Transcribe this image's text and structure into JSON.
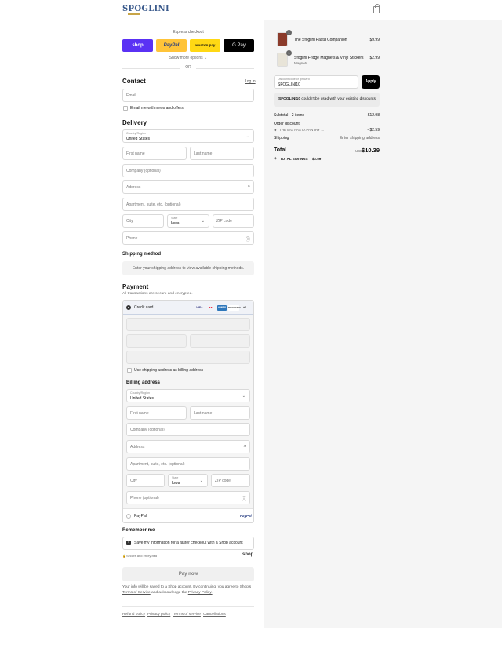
{
  "header": {
    "logo": "SPOGLINI",
    "cart_icon": "shopping-bag-icon"
  },
  "express": {
    "title": "Express checkout",
    "shop": "shop",
    "paypal": "PayPal",
    "amazon": "amazon pay",
    "gpay": "G Pay",
    "show_more": "Show more options ⌄",
    "or": "OR"
  },
  "contact": {
    "title": "Contact",
    "login": "Log in",
    "email_placeholder": "Email",
    "newsletter": "Email me with news and offers"
  },
  "delivery": {
    "title": "Delivery",
    "country_label": "Country/Region",
    "country_value": "United States",
    "first_name": "First name",
    "last_name": "Last name",
    "company": "Company (optional)",
    "address": "Address",
    "apartment": "Apartment, suite, etc. (optional)",
    "city": "City",
    "state_label": "State",
    "state_value": "Iowa",
    "zip": "ZIP code",
    "phone": "Phone"
  },
  "shipping_method": {
    "title": "Shipping method",
    "message": "Enter your shipping address to view available shipping methods."
  },
  "payment": {
    "title": "Payment",
    "subtitle": "All transactions are secure and encrypted.",
    "credit_card": "Credit card",
    "cards": [
      "VISA",
      "MC",
      "AMEX",
      "DISCOVER"
    ],
    "more_cards": "+5",
    "same_billing": "Use shipping address as billing address",
    "billing_title": "Billing address",
    "country_label": "Country/Region",
    "country_value": "United States",
    "first_name": "First name",
    "last_name": "Last name",
    "company": "Company (optional)",
    "address": "Address",
    "apartment": "Apartment, suite, etc. (optional)",
    "city": "City",
    "state_label": "State",
    "state_value": "Iowa",
    "zip": "ZIP code",
    "phone": "Phone (optional)",
    "paypal": "PayPal",
    "paypal_logo": "PayPal"
  },
  "remember": {
    "title": "Remember me",
    "save_info": "Save my information for a faster checkout with a Shop account",
    "secure": "Secure and encrypted",
    "shop": "shop"
  },
  "pay_now": "Pay now",
  "legal": {
    "text1": "Your info will be saved to a Shop account. By continuing, you agree to Shop's",
    "terms": "Terms of Service",
    "text2": "and acknowledge the",
    "privacy": "Privacy Policy."
  },
  "footer": [
    "Refund policy",
    "Privacy policy",
    "Terms of service",
    "Cancellations"
  ],
  "summary": {
    "items": [
      {
        "qty": "1",
        "name": "The Sfoglini Pasta Companion",
        "sub": "",
        "price": "$9.99"
      },
      {
        "qty": "1",
        "name": "Sfoglini Fridge Magnets & Vinyl Stickers",
        "sub": "Magnets",
        "price": "$2.99"
      }
    ],
    "discount_label": "Discount code or gift card",
    "discount_value": "SFOGLINI10",
    "apply": "Apply",
    "error_code": "SFOGLINI10",
    "error_text": " couldn't be used with your existing discounts.",
    "subtotal_label": "Subtotal · 2 items",
    "subtotal_value": "$12.98",
    "order_discount": "Order discount",
    "discount_name": "THE BIG PASTA PANTRY ...",
    "discount_amount": "- $2.59",
    "shipping_label": "Shipping",
    "shipping_value": "Enter shipping address",
    "total_label": "Total",
    "currency": "USD",
    "total_value": "$10.39",
    "savings_label": "TOTAL SAVINGS",
    "savings_value": "$2.59"
  }
}
